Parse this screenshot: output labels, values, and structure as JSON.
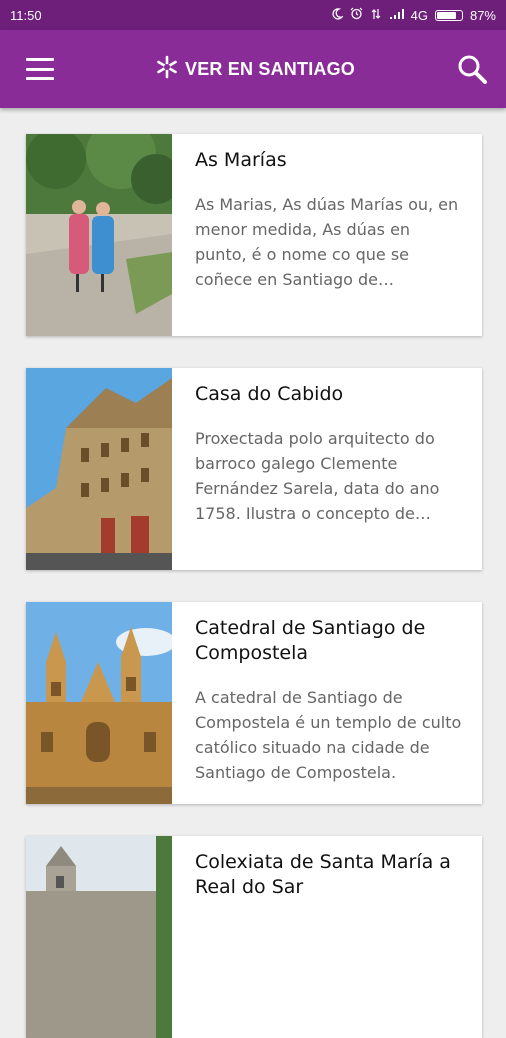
{
  "status_bar": {
    "time": "11:50",
    "network": "4G",
    "battery": "87%"
  },
  "app_bar": {
    "title": "VER EN SANTIAGO"
  },
  "items": [
    {
      "title": "As Marías",
      "description": "As Marias, As dúas Marías ou, en menor medida, As dúas en punto, é o nome co que se coñece en Santiago de Compostela a dúas irmás."
    },
    {
      "title": "Casa do Cabido",
      "description": "Proxectada polo arquitecto do barroco galego Clemente Fernández Sarela, data do ano 1758. Ilustra o concepto de arquitectura."
    },
    {
      "title": "Catedral de Santiago de Compostela",
      "description": "A catedral de Santiago de Compostela é un templo de culto católico situado na cidade de Santiago de Compostela."
    },
    {
      "title": "Colexiata de Santa María a Real do Sar",
      "description": ""
    }
  ]
}
